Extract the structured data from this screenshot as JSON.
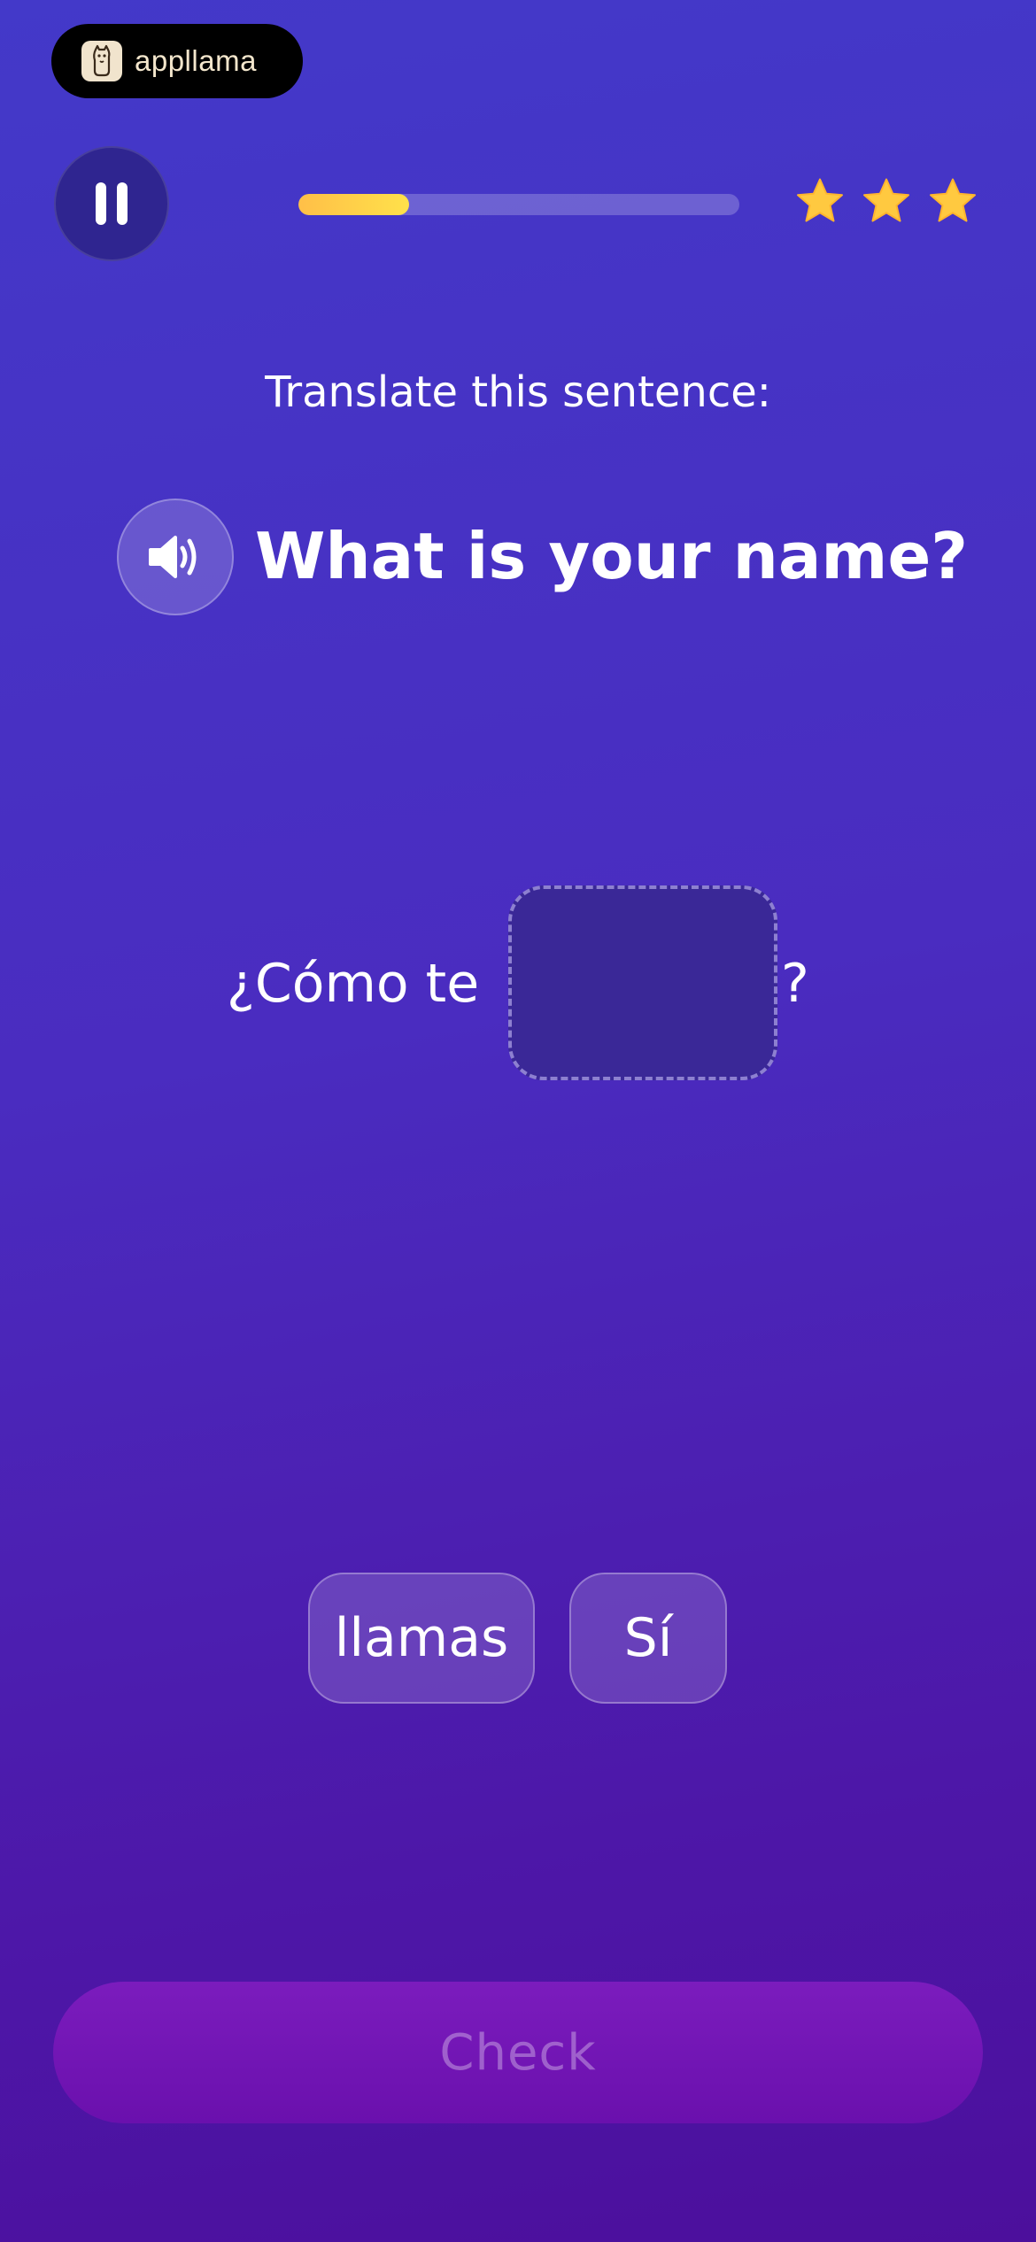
{
  "brand": {
    "name": "appllama",
    "icon": "llama-logo-icon"
  },
  "header": {
    "pause_icon": "pause-icon",
    "progress_percent": 25,
    "stars": [
      {
        "icon": "star-icon",
        "filled": true
      },
      {
        "icon": "star-icon",
        "filled": true
      },
      {
        "icon": "star-icon",
        "filled": true
      }
    ]
  },
  "exercise": {
    "instruction": "Translate this sentence:",
    "speaker_icon": "speaker-icon",
    "sentence": "What is your name?",
    "fill_before": "¿Cómo te",
    "fill_after": "?",
    "choices": [
      "llamas",
      "Sí"
    ]
  },
  "footer": {
    "check_label": "Check"
  },
  "colors": {
    "background_top": "#4339c9",
    "background_bottom": "#4c0f9c",
    "progress_fill": "#ffd34a",
    "star": "#ffc940",
    "check_button": "#7214b5"
  }
}
